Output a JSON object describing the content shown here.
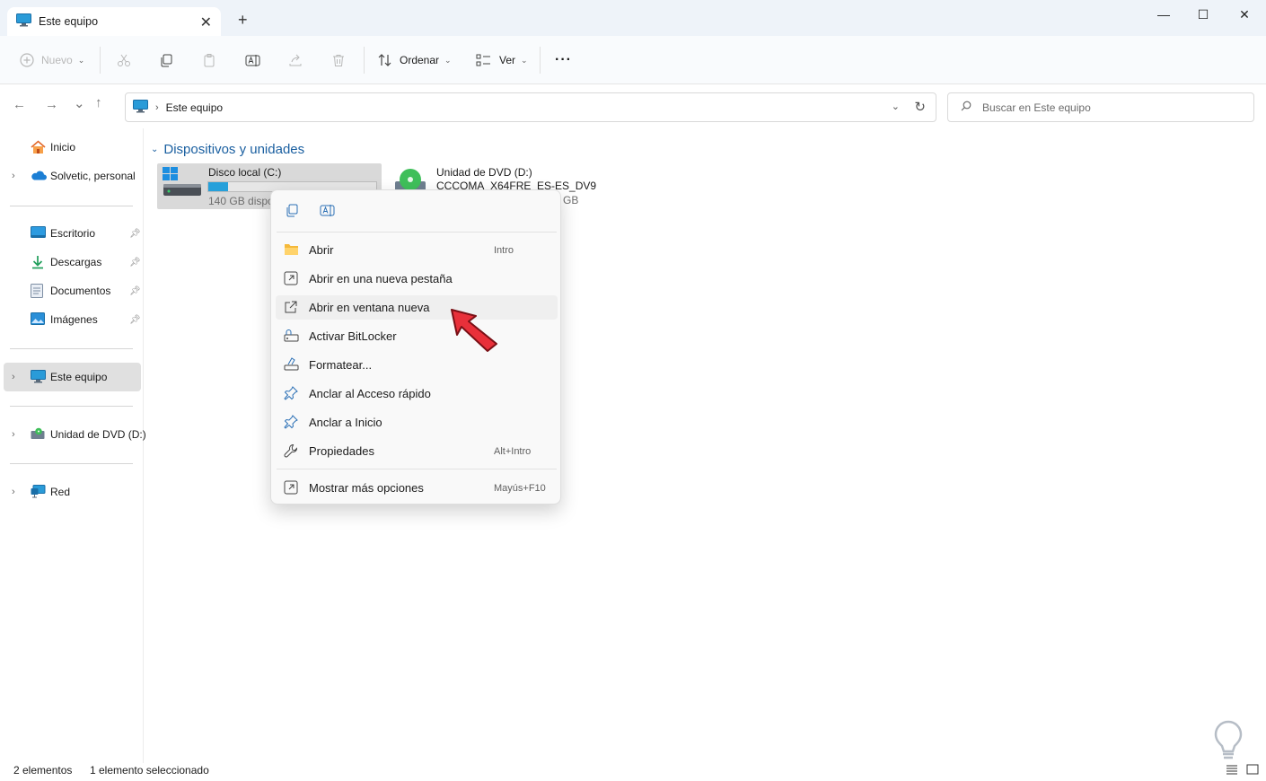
{
  "window": {
    "tab_title": "Este equipo",
    "close_tab_icon": "close-icon",
    "new_tab_glyph": "+",
    "minimize_glyph": "—",
    "maximize_glyph": "☐",
    "close_glyph": "✕"
  },
  "toolbar": {
    "new_label": "Nuevo",
    "sort_label": "Ordenar",
    "view_label": "Ver",
    "more_glyph": "···"
  },
  "navigation": {
    "back_glyph": "←",
    "forward_glyph": "→",
    "recent_glyph": "⌄",
    "up_glyph": "↑",
    "address_separator": "›",
    "address_text": "Este equipo",
    "search_placeholder": "Buscar en Este equipo"
  },
  "sidebar": {
    "items": [
      {
        "label": "Inicio"
      },
      {
        "label": "Solvetic, personal"
      },
      {
        "label": "Escritorio"
      },
      {
        "label": "Descargas"
      },
      {
        "label": "Documentos"
      },
      {
        "label": "Imágenes"
      },
      {
        "label": "Este equipo"
      },
      {
        "label": "Unidad de DVD (D:)"
      },
      {
        "label": "Red"
      }
    ]
  },
  "main": {
    "group_title": "Dispositivos y unidades",
    "drive_c": {
      "name": "Disco local (C:)",
      "free_text": "140 GB dispo",
      "used_fraction": 0.12
    },
    "drive_d": {
      "name": "Unidad de DVD (D:)",
      "label": "CCCOMA_X64FRE_ES-ES_DV9",
      "size_text": "GB"
    }
  },
  "context_menu": {
    "items": [
      {
        "label": "Abrir",
        "accel": "Intro"
      },
      {
        "label": "Abrir en una nueva pestaña",
        "accel": ""
      },
      {
        "label": "Abrir en ventana nueva",
        "accel": ""
      },
      {
        "label": "Activar BitLocker",
        "accel": ""
      },
      {
        "label": "Formatear...",
        "accel": ""
      },
      {
        "label": "Anclar al Acceso rápido",
        "accel": ""
      },
      {
        "label": "Anclar a Inicio",
        "accel": ""
      },
      {
        "label": "Propiedades",
        "accel": "Alt+Intro"
      },
      {
        "label": "Mostrar más opciones",
        "accel": "Mayús+F10"
      }
    ]
  },
  "statusbar": {
    "count": "2 elementos",
    "selection": "1 elemento seleccionado"
  },
  "colors": {
    "accent": "#1a5fa0",
    "drive_fill": "#26a0da",
    "pointer_arrow": "#e8303a"
  }
}
